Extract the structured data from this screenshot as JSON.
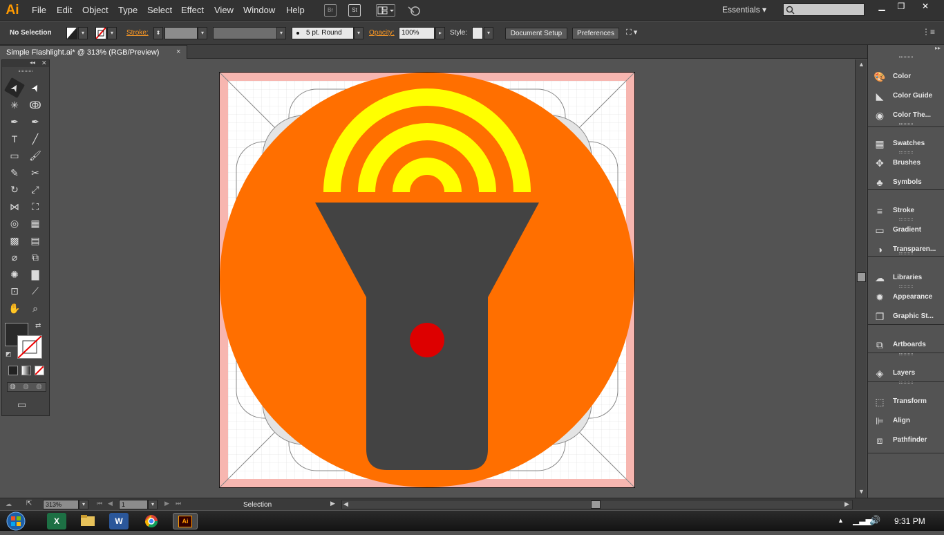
{
  "app": {
    "logo": "Ai",
    "icons": [
      "bridge-icon",
      "stock-icon",
      "arrange-documents-icon",
      "gpu-performance-icon"
    ],
    "bridge_label": "Br",
    "stock_label": "St"
  },
  "menu": {
    "items": [
      "File",
      "Edit",
      "Object",
      "Type",
      "Select",
      "Effect",
      "View",
      "Window",
      "Help"
    ]
  },
  "workspace": {
    "label": "Essentials"
  },
  "control": {
    "selection": "No Selection",
    "stroke_label": "Stroke:",
    "brush_label": "5 pt. Round",
    "opacity_label": "Opacity:",
    "opacity_value": "100%",
    "style_label": "Style:",
    "document_setup": "Document Setup",
    "preferences": "Preferences"
  },
  "document": {
    "tab_title": "Simple Flashlight.ai* @ 313% (RGB/Preview)",
    "close": "×"
  },
  "tools": [
    "selection-tool",
    "direct-selection-tool",
    "magic-wand-tool",
    "lasso-tool",
    "pen-tool",
    "curvature-tool",
    "type-tool",
    "line-segment-tool",
    "rectangle-tool",
    "paintbrush-tool",
    "pencil-tool",
    "scissors-tool",
    "rotate-tool",
    "scale-tool",
    "width-tool",
    "free-transform-tool",
    "shape-builder-tool",
    "perspective-grid-tool",
    "mesh-tool",
    "gradient-tool",
    "eyedropper-tool",
    "blend-tool",
    "symbol-sprayer-tool",
    "column-graph-tool",
    "artboard-tool",
    "slice-tool",
    "hand-tool",
    "zoom-tool"
  ],
  "artwork": {
    "colors": {
      "circle": "#ff6f00",
      "waves": "#ffff00",
      "body": "#434343",
      "button": "#dd0000",
      "artboard_bleed": "#f7b6b0"
    }
  },
  "panels": [
    {
      "label": "Color",
      "icon": "color-palette-icon"
    },
    {
      "label": "Color Guide",
      "icon": "color-guide-icon"
    },
    {
      "label": "Color The...",
      "icon": "color-themes-icon"
    },
    {
      "label": "Swatches",
      "icon": "swatches-icon"
    },
    {
      "label": "Brushes",
      "icon": "brushes-icon"
    },
    {
      "label": "Symbols",
      "icon": "symbols-icon"
    },
    {
      "label": "Stroke",
      "icon": "stroke-icon"
    },
    {
      "label": "Gradient",
      "icon": "gradient-icon"
    },
    {
      "label": "Transparen...",
      "icon": "transparency-icon"
    },
    {
      "label": "Libraries",
      "icon": "libraries-icon"
    },
    {
      "label": "Appearance",
      "icon": "appearance-icon"
    },
    {
      "label": "Graphic St...",
      "icon": "graphic-styles-icon"
    },
    {
      "label": "Artboards",
      "icon": "artboards-icon"
    },
    {
      "label": "Layers",
      "icon": "layers-icon"
    },
    {
      "label": "Transform",
      "icon": "transform-icon"
    },
    {
      "label": "Align",
      "icon": "align-icon"
    },
    {
      "label": "Pathfinder",
      "icon": "pathfinder-icon"
    }
  ],
  "status": {
    "zoom": "313%",
    "artboard_number": "1",
    "current_tool": "Selection"
  },
  "taskbar": {
    "apps": [
      "windows-start-icon",
      "excel-icon",
      "file-explorer-icon",
      "word-icon",
      "chrome-icon",
      "illustrator-icon"
    ],
    "excel_label": "X",
    "word_label": "W",
    "ai_label": "Ai",
    "clock": "9:31 PM"
  }
}
